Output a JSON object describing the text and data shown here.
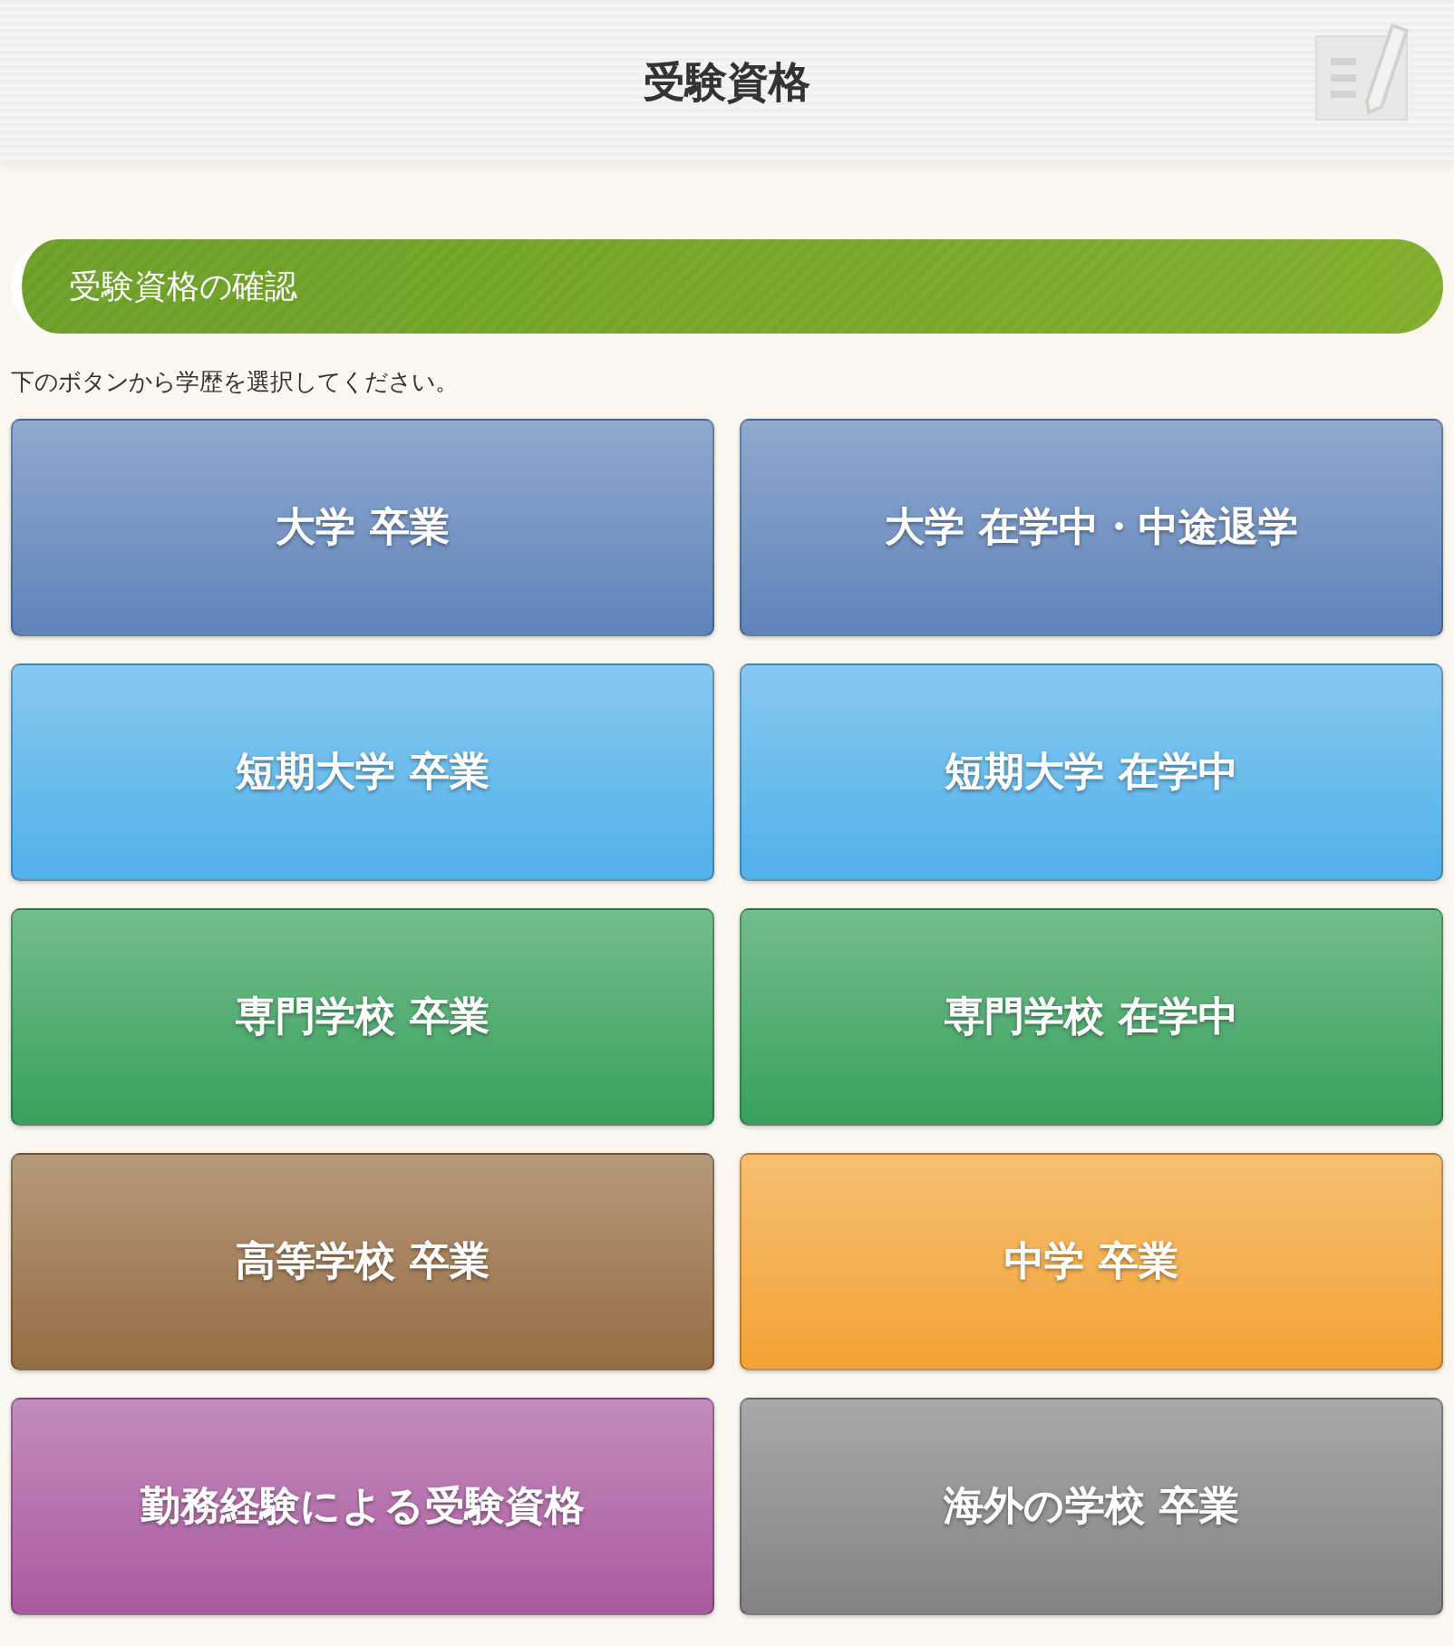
{
  "header": {
    "title": "受験資格"
  },
  "section": {
    "title": "受験資格の確認",
    "instruction": "下のボタンから学歴を選択してください。"
  },
  "options": [
    {
      "label": "大学 卒業",
      "color": "#5f84ba"
    },
    {
      "label": "大学 在学中・中途退学",
      "color": "#5f84ba"
    },
    {
      "label": "短期大学 卒業",
      "color": "#52b1ea"
    },
    {
      "label": "短期大学 在学中",
      "color": "#52b1ea"
    },
    {
      "label": "専門学校 卒業",
      "color": "#38a05c"
    },
    {
      "label": "専門学校 在学中",
      "color": "#38a05c"
    },
    {
      "label": "高等学校 卒業",
      "color": "#976c42"
    },
    {
      "label": "中学 卒業",
      "color": "#f3a335"
    },
    {
      "label": "勤務経験による受験資格",
      "color": "#aa5aa0"
    },
    {
      "label": "海外の学校 卒業",
      "color": "#838383"
    }
  ]
}
